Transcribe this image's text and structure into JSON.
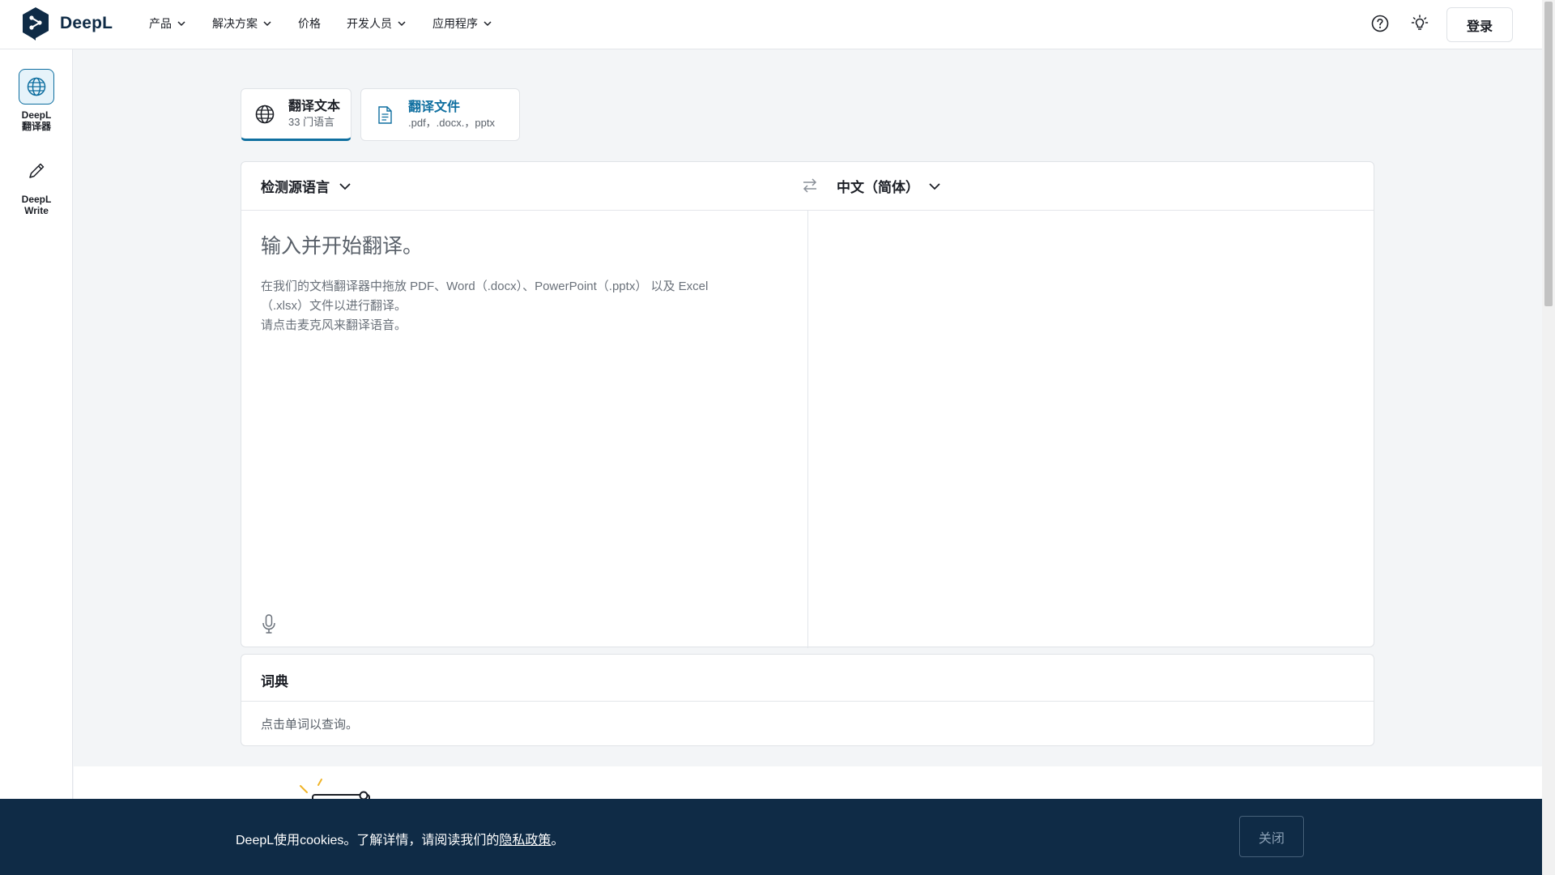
{
  "header": {
    "brand": "DeepL",
    "nav": [
      {
        "label": "产品",
        "has_dropdown": true
      },
      {
        "label": "解决方案",
        "has_dropdown": true
      },
      {
        "label": "价格",
        "has_dropdown": false
      },
      {
        "label": "开发人员",
        "has_dropdown": true
      },
      {
        "label": "应用程序",
        "has_dropdown": true
      }
    ],
    "icons": [
      "help-icon",
      "lightbulb-icon"
    ],
    "login_label": "登录"
  },
  "sidebar": {
    "items": [
      {
        "label": "DeepL\n翻译器",
        "icon": "globe-icon",
        "active": true
      },
      {
        "label": "DeepL\nWrite",
        "icon": "pencil-icon",
        "active": false
      }
    ]
  },
  "tabs": {
    "text": {
      "title": "翻译文本",
      "subtitle": "33 门语言"
    },
    "file": {
      "title": "翻译文件",
      "subtitle": ".pdf，.docx.，pptx"
    }
  },
  "translator": {
    "source_lang": "检测源语言",
    "target_lang": "中文（简体）",
    "placeholder": "输入并开始翻译。",
    "hint_line1": "在我们的文档翻译器中拖放 PDF、Word（.docx）、PowerPoint（.pptx） 以及 Excel",
    "hint_line2": "（.xlsx）文件以进行翻译。",
    "hint_line3": "请点击麦克风来翻译语音。"
  },
  "dictionary": {
    "title": "词典",
    "hint": "点击单词以查询。"
  },
  "cookie": {
    "text_before": "DeepL使用cookies。了解详情，请阅读我们的",
    "link": "隐私政策",
    "text_after": "。",
    "close_label": "关闭"
  },
  "colors": {
    "brand_navy": "#0f2b46",
    "accent_blue": "#0f6fa0",
    "page_bg": "#f3f5f7"
  }
}
